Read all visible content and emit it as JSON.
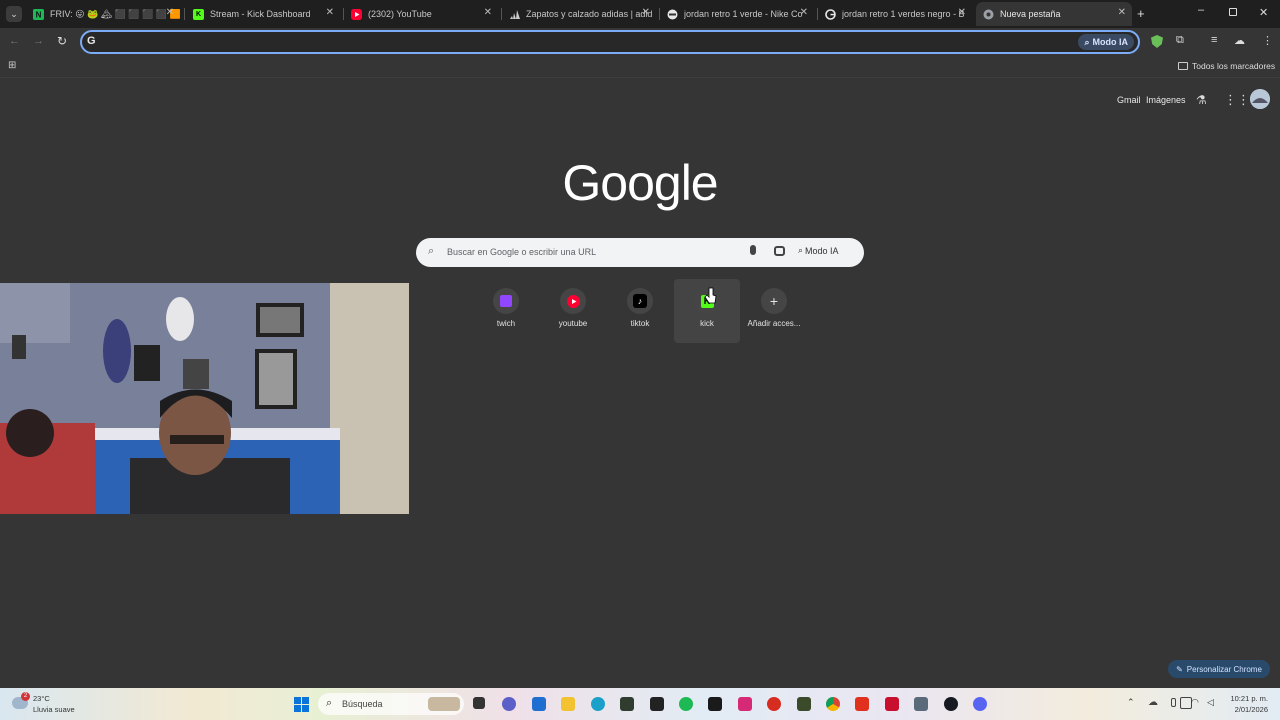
{
  "tabs": [
    {
      "title": "FRIV: 😛 🐸 🏔 ⬛ ⬛ ⬛ ⬛ 🟧",
      "favicon_color": "#1db954",
      "active": false
    },
    {
      "title": "Stream - Kick Dashboard",
      "favicon_color": "#53fc18",
      "active": false
    },
    {
      "title": "(2302) YouTube",
      "favicon_color": "#ff0033",
      "active": false
    },
    {
      "title": "Zapatos y calzado adidas | adid",
      "favicon_color": "#111111",
      "active": false
    },
    {
      "title": "jordan retro 1 verde - Nike Co",
      "favicon_color": "#dddddd",
      "active": false
    },
    {
      "title": "jordan retro 1 verdes negro - B",
      "favicon_color": "#dddddd",
      "active": false
    },
    {
      "title": "Nueva pestaña",
      "favicon_color": "#9aa0a6",
      "active": true
    }
  ],
  "toolbar": {
    "ai_mode_label": "Modo IA"
  },
  "bookmarks": {
    "all_bookmarks_label": "Todos los marcadores"
  },
  "google": {
    "header_links": [
      "Gmail",
      "Imágenes"
    ],
    "logo_text": "Google",
    "search_placeholder": "Buscar en Google o escribir una URL",
    "ai_mode_label": "Modo IA"
  },
  "shortcuts": [
    {
      "label": "twich",
      "icon": "twitch-icon",
      "color": "#9146ff"
    },
    {
      "label": "youtube",
      "icon": "youtube-icon",
      "color": "#ff0033"
    },
    {
      "label": "tiktok",
      "icon": "tiktok-icon",
      "color": "#000000"
    },
    {
      "label": "kick",
      "icon": "kick-icon",
      "color": "#53fc18"
    },
    {
      "label": "Añadir acces...",
      "icon": "plus-icon",
      "color": "#454545"
    }
  ],
  "customize": {
    "label": "Personalizar Chrome"
  },
  "taskbar": {
    "weather_temp": "23°C",
    "weather_desc": "Lluvia suave",
    "search_placeholder": "Búsqueda",
    "time": "10:21 p. m.",
    "date": "2/01/2026",
    "notification_count": "2"
  }
}
